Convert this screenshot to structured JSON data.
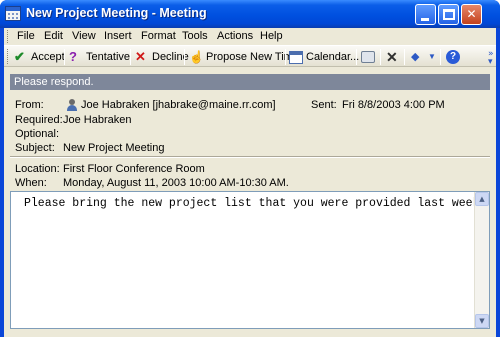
{
  "window": {
    "title": "New Project Meeting - Meeting"
  },
  "menu": {
    "items": [
      "File",
      "Edit",
      "View",
      "Insert",
      "Format",
      "Tools",
      "Actions",
      "Help"
    ]
  },
  "toolbar": {
    "accept": "Accept",
    "tentative": "Tentative",
    "decline": "Decline",
    "propose": "Propose New Time",
    "calendar": "Calendar..."
  },
  "infobar": {
    "text": "Please respond."
  },
  "header": {
    "from_label": "From:",
    "from_value": "Joe Habraken [jhabrake@maine.rr.com]",
    "sent_label": "Sent:",
    "sent_value": "Fri 8/8/2003 4:00 PM",
    "required_label": "Required:",
    "required_value": "Joe Habraken",
    "optional_label": "Optional:",
    "optional_value": "",
    "subject_label": "Subject:",
    "subject_value": "New Project Meeting",
    "location_label": "Location:",
    "location_value": "First Floor Conference Room",
    "when_label": "When:",
    "when_value": "Monday, August 11, 2003 10:00 AM-10:30 AM."
  },
  "body": {
    "text": "Please bring the new project list that you were provided last week."
  },
  "icons": {
    "app": "calendar-icon",
    "accept": "checkmark-icon",
    "tentative": "question-icon",
    "decline": "x-icon",
    "propose": "hand-icon",
    "calendar": "calendar-icon",
    "print": "print-icon",
    "delete": "delete-icon",
    "previous": "up-arrow-icon",
    "help": "help-icon",
    "sender": "person-icon"
  },
  "colors": {
    "titlebar": "#0050e0",
    "infobar": "#7e879a",
    "chrome": "#ece9d8"
  }
}
